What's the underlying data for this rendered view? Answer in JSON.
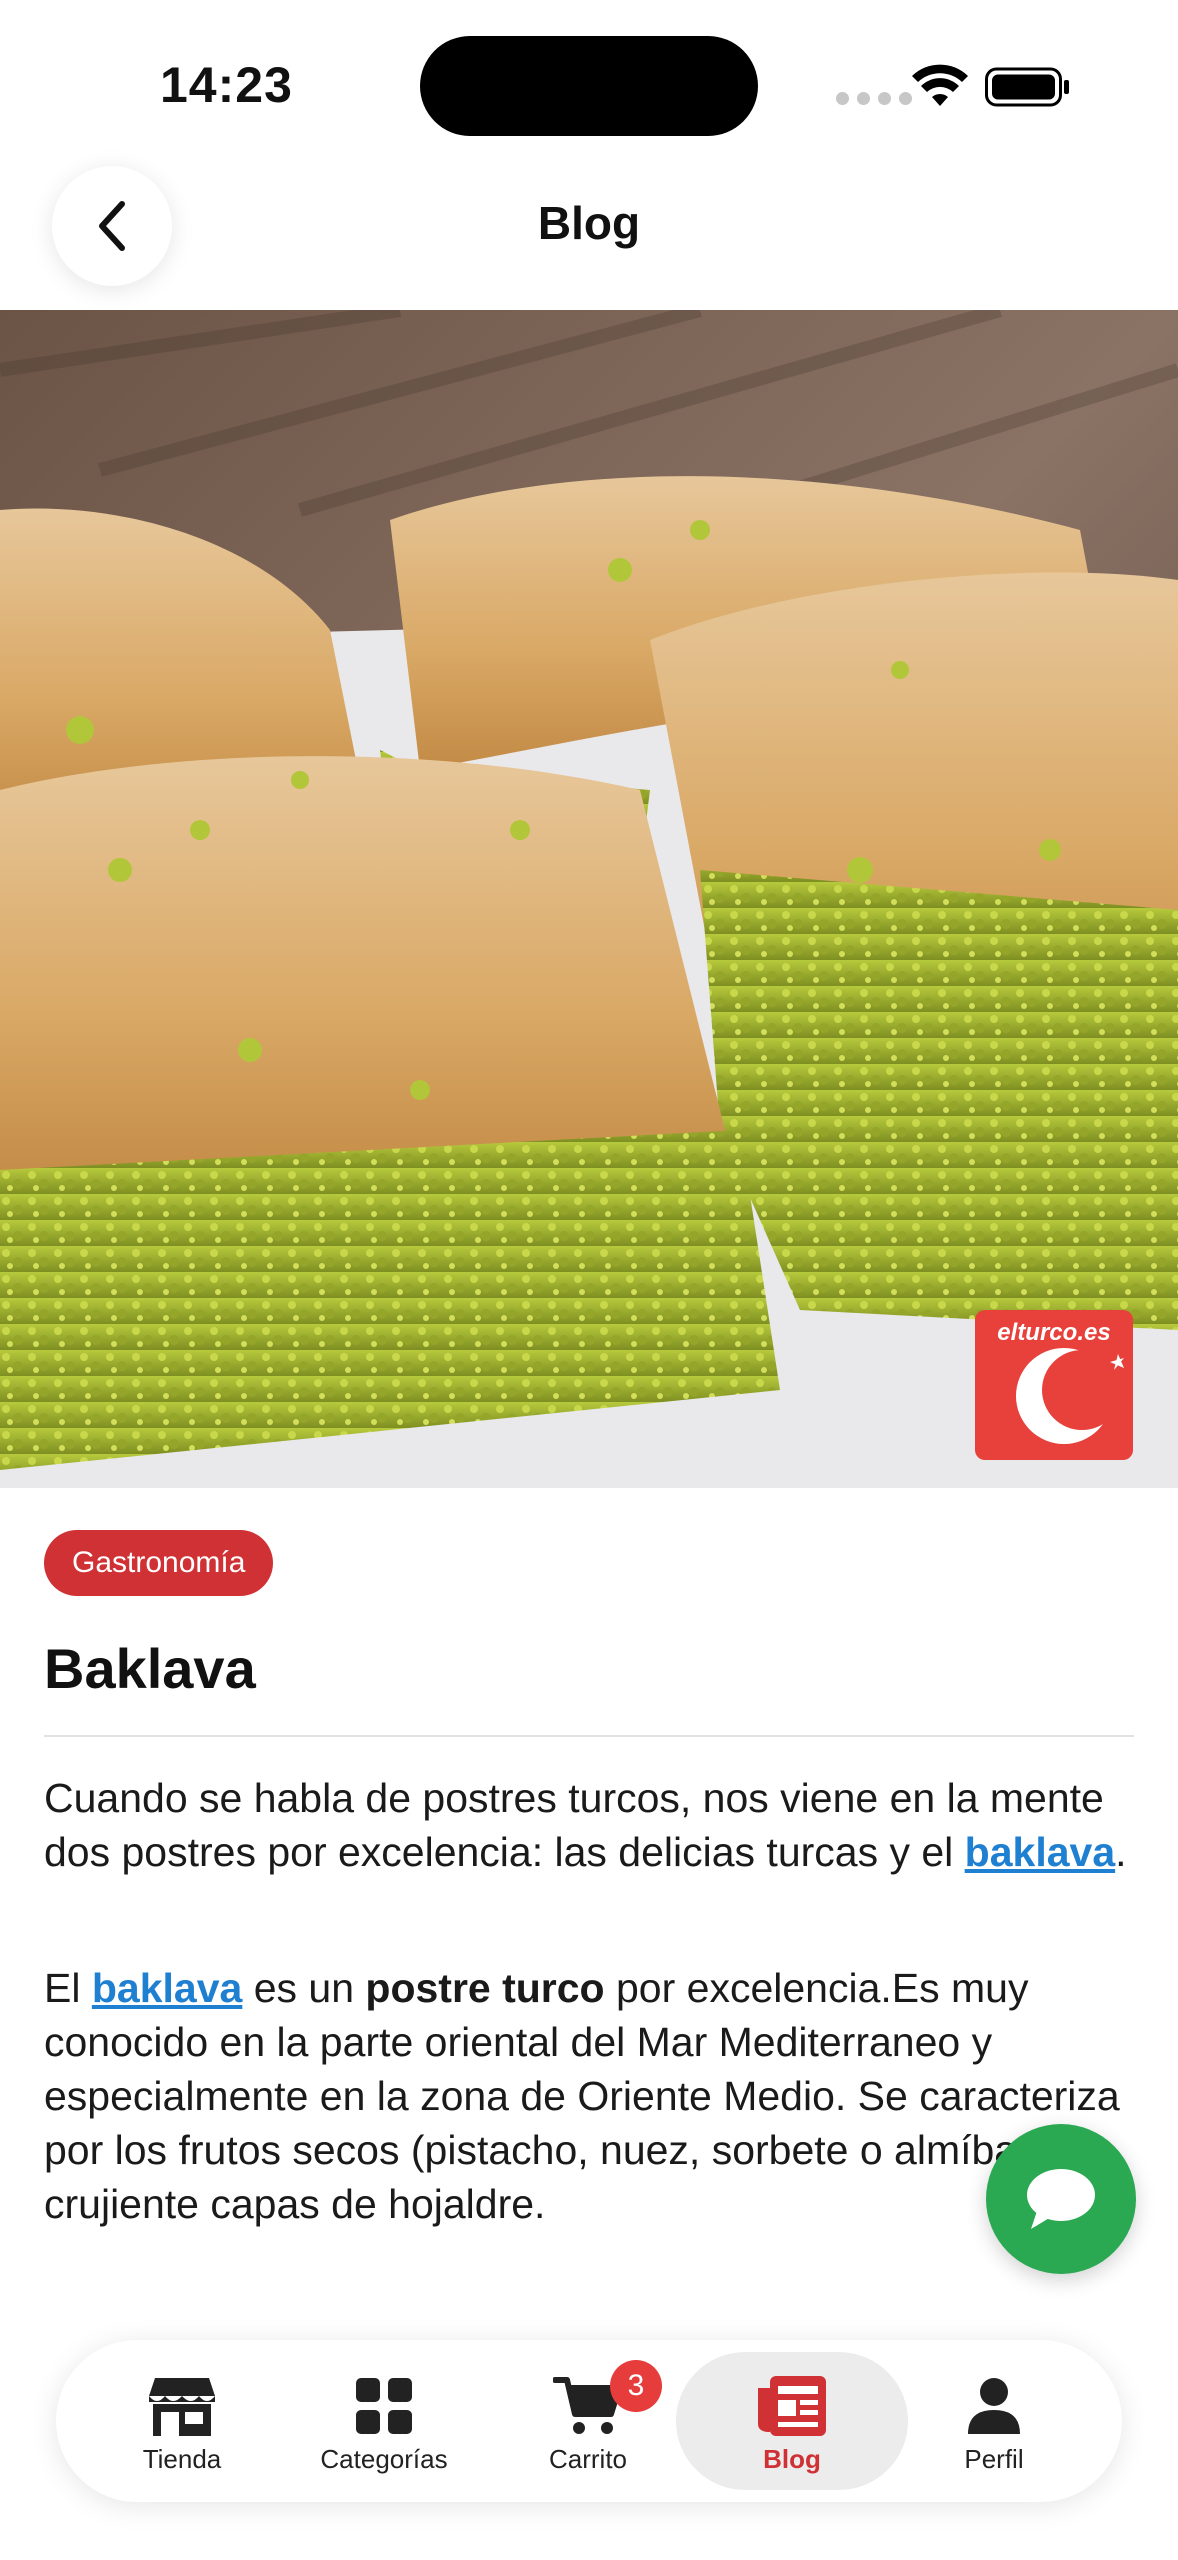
{
  "status_bar": {
    "time": "14:23"
  },
  "header": {
    "title": "Blog",
    "back_icon": "chevron-left-icon"
  },
  "hero": {
    "watermark": "elturco.es",
    "alt": "baklava photo"
  },
  "article": {
    "category": "Gastronomía",
    "title": "Baklava",
    "p1_text_a": "Cuando se habla de postres turcos, nos viene en la mente dos postres por excelencia: las delicias turcas y el ",
    "p1_link": "baklava",
    "p1_text_b": ".",
    "p2_text_a": "El ",
    "p2_link": "baklava",
    "p2_text_b": " es un ",
    "p2_bold": "postre turco",
    "p2_text_c": " por excelencia.Es muy conocido en la parte oriental del Mar Mediterraneo y especialmente en la zona de Oriente Medio. Se caracteriza por los frutos secos (pistacho, nuez, sorbete o almíbar con crujiente capas de hojaldre."
  },
  "nav": {
    "items": [
      {
        "label": "Tienda",
        "icon": "store-icon"
      },
      {
        "label": "Categorías",
        "icon": "grid-icon"
      },
      {
        "label": "Carrito",
        "icon": "cart-icon",
        "badge": "3"
      },
      {
        "label": "Blog",
        "icon": "newspaper-icon",
        "active": true
      },
      {
        "label": "Perfil",
        "icon": "person-icon"
      }
    ]
  },
  "colors": {
    "accent": "#cf3135",
    "link": "#1f7fd1",
    "chat": "#2aa852"
  }
}
